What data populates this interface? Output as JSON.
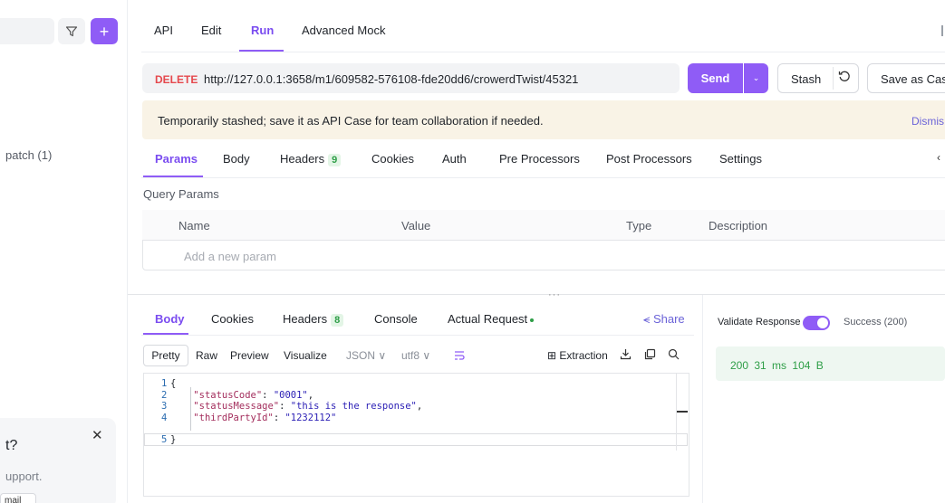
{
  "sidebar": {
    "item_label": "patch (1)",
    "help_title": "t?",
    "help_text": "upport.",
    "help_button": "mail",
    "close_glyph": "✕",
    "add_glyph": "+",
    "filter_glyph": "▽"
  },
  "top_tabs": [
    "API",
    "Edit",
    "Run",
    "Advanced Mock"
  ],
  "request": {
    "method": "DELETE",
    "url": "http://127.0.0.1:3658/m1/609582-576108-fde20dd6/crowerdTwist/45321",
    "send_label": "Send",
    "stash_label": "Stash",
    "save_as_label": "Save as Cas"
  },
  "notice": {
    "text": "Temporarily stashed; save it as API Case for team collaboration if needed.",
    "dismiss": "Dismis"
  },
  "request_tabs": {
    "params": "Params",
    "body": "Body",
    "headers": "Headers",
    "headers_count": "9",
    "cookies": "Cookies",
    "auth": "Auth",
    "pre": "Pre Processors",
    "post": "Post Processors",
    "settings": "Settings"
  },
  "query_params": {
    "title": "Query Params",
    "columns": [
      "Name",
      "Value",
      "Type",
      "Description"
    ],
    "placeholder": "Add a new param"
  },
  "response_tabs": {
    "body": "Body",
    "cookies": "Cookies",
    "headers": "Headers",
    "headers_count": "8",
    "console": "Console",
    "actual": "Actual Request",
    "share": "Share"
  },
  "body_toolbar": {
    "pretty": "Pretty",
    "raw": "Raw",
    "preview": "Preview",
    "visualize": "Visualize",
    "format": "JSON",
    "encoding": "utf8",
    "extraction": "Extraction"
  },
  "code_lines": [
    {
      "num": "1",
      "pre": "{",
      "key": "",
      "sep": "",
      "val": "",
      "post": ""
    },
    {
      "num": "2",
      "pre": "    ",
      "key": "\"statusCode\"",
      "sep": ": ",
      "val": "\"0001\"",
      "post": ","
    },
    {
      "num": "3",
      "pre": "    ",
      "key": "\"statusMessage\"",
      "sep": ": ",
      "val": "\"this is the response\"",
      "post": ","
    },
    {
      "num": "4",
      "pre": "    ",
      "key": "\"thirdPartyId\"",
      "sep": ": ",
      "val": "\"1232112\"",
      "post": ""
    },
    {
      "num": "5",
      "pre": "}",
      "key": "",
      "sep": "",
      "val": "",
      "post": ""
    }
  ],
  "validation": {
    "label": "Validate Response",
    "enabled": true,
    "success": "Success (200)"
  },
  "response_meta": {
    "status": "200",
    "time": "31 ms",
    "size": "104 B"
  },
  "colors": {
    "accent": "#8f5cf6",
    "method_delete": "#e5484d",
    "success": "#2e9e47",
    "notice_bg": "#f9f3e6"
  }
}
